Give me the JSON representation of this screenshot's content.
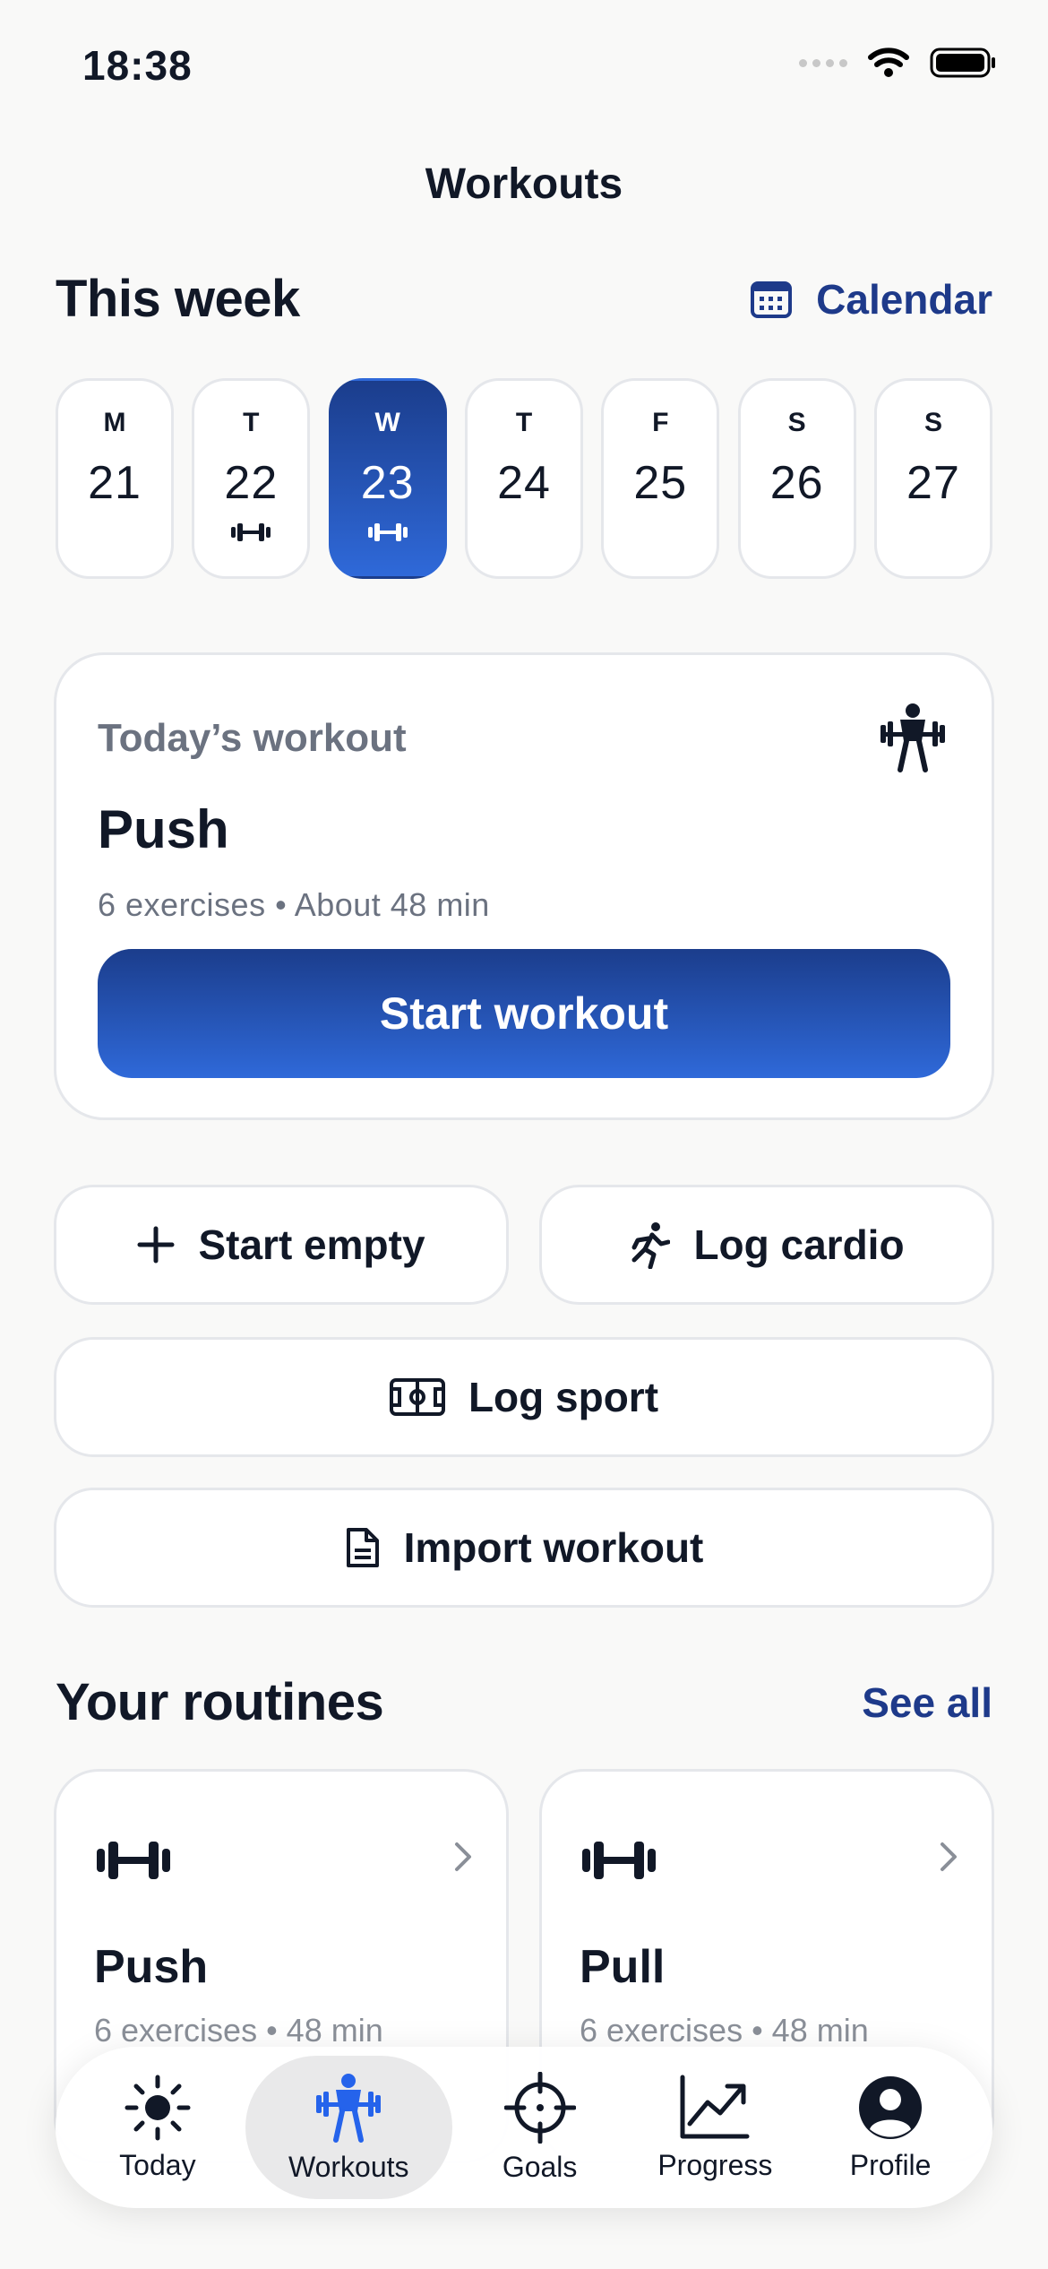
{
  "status": {
    "time": "18:38"
  },
  "nav": {
    "title": "Workouts"
  },
  "this_week": {
    "title": "This week",
    "calendar_label": "Calendar",
    "days": [
      {
        "letter": "M",
        "date": "21",
        "has_workout": false,
        "selected": false
      },
      {
        "letter": "T",
        "date": "22",
        "has_workout": true,
        "selected": false
      },
      {
        "letter": "W",
        "date": "23",
        "has_workout": true,
        "selected": true
      },
      {
        "letter": "T",
        "date": "24",
        "has_workout": false,
        "selected": false
      },
      {
        "letter": "F",
        "date": "25",
        "has_workout": false,
        "selected": false
      },
      {
        "letter": "S",
        "date": "26",
        "has_workout": false,
        "selected": false
      },
      {
        "letter": "S",
        "date": "27",
        "has_workout": false,
        "selected": false
      }
    ]
  },
  "today": {
    "label": "Today’s workout",
    "name": "Push",
    "meta": "6 exercises • About 48 min",
    "start_label": "Start workout"
  },
  "actions": {
    "start_empty": "Start empty",
    "log_cardio": "Log cardio",
    "log_sport": "Log sport",
    "import_workout": "Import workout"
  },
  "routines": {
    "title": "Your routines",
    "see_all": "See all",
    "items": [
      {
        "name": "Push",
        "meta": "6 exercises • 48 min"
      },
      {
        "name": "Pull",
        "meta": "6 exercises • 48 min"
      }
    ]
  },
  "tabs": [
    {
      "label": "Today",
      "icon": "sun-icon",
      "active": false
    },
    {
      "label": "Workouts",
      "icon": "weightlifter-icon",
      "active": true
    },
    {
      "label": "Goals",
      "icon": "target-icon",
      "active": false
    },
    {
      "label": "Progress",
      "icon": "chart-icon",
      "active": false
    },
    {
      "label": "Profile",
      "icon": "person-icon",
      "active": false
    }
  ],
  "colors": {
    "accent": "#1e3a8a",
    "accent_gradient_top": "#1b3d8c",
    "accent_gradient_bottom": "#2f69d9",
    "background": "#f9f9f8"
  }
}
